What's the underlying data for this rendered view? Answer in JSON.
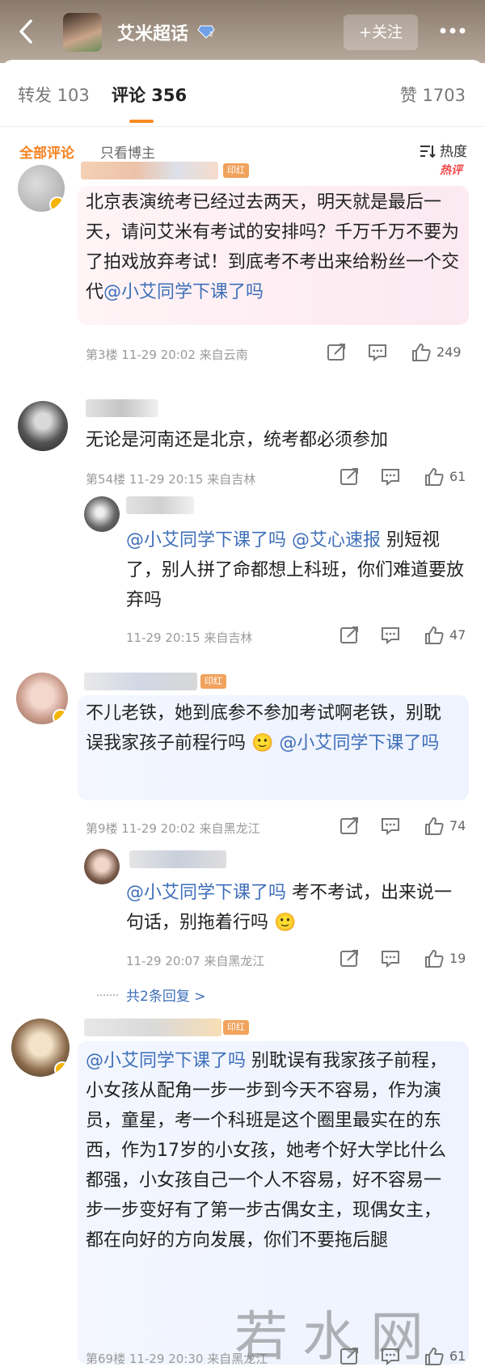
{
  "header": {
    "title": "艾米超话",
    "follow_label": "+关注",
    "icons": [
      "back-icon",
      "gem-badge-icon",
      "more-icon"
    ]
  },
  "tabs": {
    "repost": "转发 103",
    "comment": "评论 356",
    "like": "赞 1703"
  },
  "filters": {
    "all": "全部评论",
    "op_only": "只看博主",
    "sort": "热度"
  },
  "comments": [
    {
      "badge": "印红",
      "hot": "热评",
      "text_plain": "北京表演统考已经过去两天，明天就是最后一天，请问艾米有考试的安排吗？千万千万不要为了拍戏放弃考试！到底考不考出来给粉丝一个交代",
      "mention": "@小艾同学下课了吗",
      "meta": "第3楼  11-29 20:02  来自云南",
      "likes": "249"
    },
    {
      "text_plain": "无论是河南还是北京，统考都必须参加",
      "meta": "第54楼  11-29 20:15  来自吉林",
      "likes": "61",
      "reply": {
        "mention1": "@小艾同学下课了吗",
        "mention2": "@艾心速报",
        "text_plain": "别短视了，别人拼了命都想上科班，你们难道要放弃吗",
        "meta": "11-29 20:15  来自吉林",
        "likes": "47"
      }
    },
    {
      "badge": "印红",
      "text_plain": "不儿老铁，她到底参不参加考试啊老铁，别耽误我家孩子前程行吗",
      "mention": "@小艾同学下课了吗",
      "meta": "第9楼  11-29 20:02  来自黑龙江",
      "likes": "74",
      "reply": {
        "mention1": "@小艾同学下课了吗",
        "text_plain": "考不考试，出来说一句话，别拖着行吗",
        "meta": "11-29 20:07  来自黑龙江",
        "likes": "19"
      },
      "more_replies": "共2条回复 >"
    },
    {
      "badge": "印红",
      "mention": "@小艾同学下课了吗",
      "text_plain": "别耽误有我家孩子前程，小女孩从配角一步一步到今天不容易，作为演员，童星，考一个科班是这个圈里最实在的东西，作为17岁的小女孩，她考个好大学比什么都强，小女孩自己一个人不容易，好不容易一步一步变好有了第一步古偶女主，现偶女主，都在向好的方向发展，你们不要拖后腿",
      "meta": "第69楼  11-29 20:30  来自黑龙江",
      "likes": "61"
    }
  ],
  "watermark": "若水网",
  "colors": {
    "accent": "#f58220",
    "link": "#3e6fb8",
    "hot": "#f04a4a"
  }
}
